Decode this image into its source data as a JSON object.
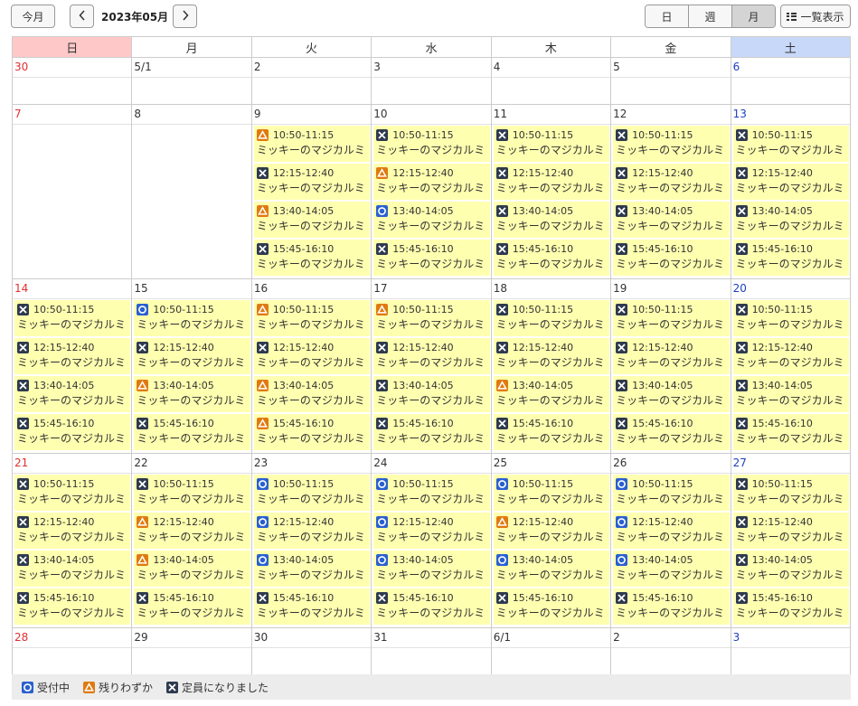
{
  "toolbar": {
    "today_label": "今月",
    "prev_label": "<",
    "next_label": ">",
    "month_title": "2023年05月",
    "views": [
      "日",
      "週",
      "月"
    ],
    "active_view": "月",
    "list_label": "一覧表示"
  },
  "weekdays": [
    "日",
    "月",
    "火",
    "水",
    "木",
    "金",
    "土"
  ],
  "status_types": {
    "open": {
      "label": "受付中",
      "icon": "circle-icon",
      "color": "#2a60d0"
    },
    "few": {
      "label": "残りわずか",
      "icon": "triangle-icon",
      "color": "#e07a10"
    },
    "full": {
      "label": "定員になりました",
      "icon": "x-icon",
      "color": "#2e3a4e"
    }
  },
  "event_title": "ミッキーのマジカルミ",
  "weeks": [
    {
      "days": [
        {
          "date": "30",
          "events": []
        },
        {
          "date": "5/1",
          "events": []
        },
        {
          "date": "2",
          "events": []
        },
        {
          "date": "3",
          "events": []
        },
        {
          "date": "4",
          "events": []
        },
        {
          "date": "5",
          "events": []
        },
        {
          "date": "6",
          "events": []
        }
      ]
    },
    {
      "days": [
        {
          "date": "7",
          "events": []
        },
        {
          "date": "8",
          "events": []
        },
        {
          "date": "9",
          "events": [
            {
              "time": "10:50-11:15",
              "status": "few"
            },
            {
              "time": "12:15-12:40",
              "status": "full"
            },
            {
              "time": "13:40-14:05",
              "status": "few"
            },
            {
              "time": "15:45-16:10",
              "status": "full"
            }
          ]
        },
        {
          "date": "10",
          "events": [
            {
              "time": "10:50-11:15",
              "status": "full"
            },
            {
              "time": "12:15-12:40",
              "status": "few"
            },
            {
              "time": "13:40-14:05",
              "status": "open"
            },
            {
              "time": "15:45-16:10",
              "status": "full"
            }
          ]
        },
        {
          "date": "11",
          "events": [
            {
              "time": "10:50-11:15",
              "status": "full"
            },
            {
              "time": "12:15-12:40",
              "status": "full"
            },
            {
              "time": "13:40-14:05",
              "status": "full"
            },
            {
              "time": "15:45-16:10",
              "status": "full"
            }
          ]
        },
        {
          "date": "12",
          "events": [
            {
              "time": "10:50-11:15",
              "status": "full"
            },
            {
              "time": "12:15-12:40",
              "status": "full"
            },
            {
              "time": "13:40-14:05",
              "status": "full"
            },
            {
              "time": "15:45-16:10",
              "status": "full"
            }
          ]
        },
        {
          "date": "13",
          "events": [
            {
              "time": "10:50-11:15",
              "status": "full"
            },
            {
              "time": "12:15-12:40",
              "status": "full"
            },
            {
              "time": "13:40-14:05",
              "status": "full"
            },
            {
              "time": "15:45-16:10",
              "status": "full"
            }
          ]
        }
      ]
    },
    {
      "days": [
        {
          "date": "14",
          "events": [
            {
              "time": "10:50-11:15",
              "status": "full"
            },
            {
              "time": "12:15-12:40",
              "status": "full"
            },
            {
              "time": "13:40-14:05",
              "status": "full"
            },
            {
              "time": "15:45-16:10",
              "status": "full"
            }
          ]
        },
        {
          "date": "15",
          "events": [
            {
              "time": "10:50-11:15",
              "status": "open"
            },
            {
              "time": "12:15-12:40",
              "status": "full"
            },
            {
              "time": "13:40-14:05",
              "status": "few"
            },
            {
              "time": "15:45-16:10",
              "status": "full"
            }
          ]
        },
        {
          "date": "16",
          "events": [
            {
              "time": "10:50-11:15",
              "status": "few"
            },
            {
              "time": "12:15-12:40",
              "status": "full"
            },
            {
              "time": "13:40-14:05",
              "status": "few"
            },
            {
              "time": "15:45-16:10",
              "status": "few"
            }
          ]
        },
        {
          "date": "17",
          "events": [
            {
              "time": "10:50-11:15",
              "status": "few"
            },
            {
              "time": "12:15-12:40",
              "status": "full"
            },
            {
              "time": "13:40-14:05",
              "status": "full"
            },
            {
              "time": "15:45-16:10",
              "status": "full"
            }
          ]
        },
        {
          "date": "18",
          "events": [
            {
              "time": "10:50-11:15",
              "status": "full"
            },
            {
              "time": "12:15-12:40",
              "status": "full"
            },
            {
              "time": "13:40-14:05",
              "status": "few"
            },
            {
              "time": "15:45-16:10",
              "status": "full"
            }
          ]
        },
        {
          "date": "19",
          "events": [
            {
              "time": "10:50-11:15",
              "status": "full"
            },
            {
              "time": "12:15-12:40",
              "status": "full"
            },
            {
              "time": "13:40-14:05",
              "status": "full"
            },
            {
              "time": "15:45-16:10",
              "status": "full"
            }
          ]
        },
        {
          "date": "20",
          "events": [
            {
              "time": "10:50-11:15",
              "status": "full"
            },
            {
              "time": "12:15-12:40",
              "status": "full"
            },
            {
              "time": "13:40-14:05",
              "status": "full"
            },
            {
              "time": "15:45-16:10",
              "status": "full"
            }
          ]
        }
      ]
    },
    {
      "days": [
        {
          "date": "21",
          "events": [
            {
              "time": "10:50-11:15",
              "status": "full"
            },
            {
              "time": "12:15-12:40",
              "status": "full"
            },
            {
              "time": "13:40-14:05",
              "status": "full"
            },
            {
              "time": "15:45-16:10",
              "status": "full"
            }
          ]
        },
        {
          "date": "22",
          "events": [
            {
              "time": "10:50-11:15",
              "status": "full"
            },
            {
              "time": "12:15-12:40",
              "status": "few"
            },
            {
              "time": "13:40-14:05",
              "status": "few"
            },
            {
              "time": "15:45-16:10",
              "status": "full"
            }
          ]
        },
        {
          "date": "23",
          "events": [
            {
              "time": "10:50-11:15",
              "status": "open"
            },
            {
              "time": "12:15-12:40",
              "status": "open"
            },
            {
              "time": "13:40-14:05",
              "status": "open"
            },
            {
              "time": "15:45-16:10",
              "status": "full"
            }
          ]
        },
        {
          "date": "24",
          "events": [
            {
              "time": "10:50-11:15",
              "status": "open"
            },
            {
              "time": "12:15-12:40",
              "status": "open"
            },
            {
              "time": "13:40-14:05",
              "status": "open"
            },
            {
              "time": "15:45-16:10",
              "status": "full"
            }
          ]
        },
        {
          "date": "25",
          "events": [
            {
              "time": "10:50-11:15",
              "status": "open"
            },
            {
              "time": "12:15-12:40",
              "status": "few"
            },
            {
              "time": "13:40-14:05",
              "status": "open"
            },
            {
              "time": "15:45-16:10",
              "status": "full"
            }
          ]
        },
        {
          "date": "26",
          "events": [
            {
              "time": "10:50-11:15",
              "status": "open"
            },
            {
              "time": "12:15-12:40",
              "status": "open"
            },
            {
              "time": "13:40-14:05",
              "status": "open"
            },
            {
              "time": "15:45-16:10",
              "status": "full"
            }
          ]
        },
        {
          "date": "27",
          "events": [
            {
              "time": "10:50-11:15",
              "status": "full"
            },
            {
              "time": "12:15-12:40",
              "status": "full"
            },
            {
              "time": "13:40-14:05",
              "status": "full"
            },
            {
              "time": "15:45-16:10",
              "status": "full"
            }
          ]
        }
      ]
    },
    {
      "days": [
        {
          "date": "28",
          "events": []
        },
        {
          "date": "29",
          "events": []
        },
        {
          "date": "30",
          "events": []
        },
        {
          "date": "31",
          "events": []
        },
        {
          "date": "6/1",
          "events": []
        },
        {
          "date": "2",
          "events": []
        },
        {
          "date": "3",
          "events": []
        }
      ]
    }
  ],
  "legend": [
    {
      "status": "open",
      "label": "受付中"
    },
    {
      "status": "few",
      "label": "残りわずか"
    },
    {
      "status": "full",
      "label": "定員になりました"
    }
  ]
}
